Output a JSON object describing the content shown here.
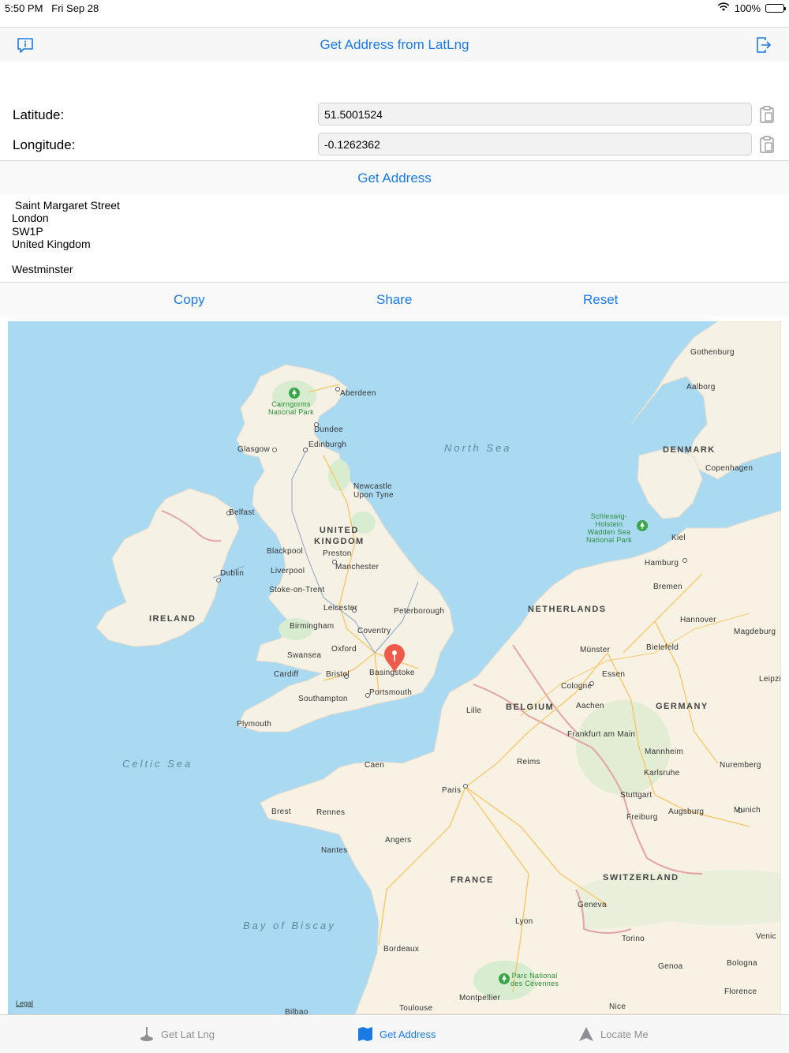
{
  "status": {
    "time": "5:50 PM",
    "date": "Fri Sep 28",
    "battery": "100%",
    "battery_level": 1.0
  },
  "nav": {
    "title": "Get Address from LatLng",
    "left_icon": "info-bubble-icon",
    "right_icon": "logout-icon"
  },
  "form": {
    "latitude_label": "Latitude:",
    "latitude_value": "51.5001524",
    "longitude_label": "Longitude:",
    "longitude_value": "-0.1262362"
  },
  "get_address_button": "Get Address",
  "address": {
    "text": " Saint Margaret Street\nLondon\nSW1P\nUnited Kingdom\n\nWestminster"
  },
  "actions": {
    "copy": "Copy",
    "share": "Share",
    "reset": "Reset"
  },
  "map": {
    "legal": "Legal",
    "labels": {
      "gothenburg": "Gothenburg",
      "aalborg": "Aalborg",
      "aberdeen": "Aberdeen",
      "dundee": "Dundee",
      "glasgow": "Glasgow",
      "edinburgh": "Edinburgh",
      "north_sea": "North Sea",
      "denmark": "DENMARK",
      "copenhagen": "Copenhagen",
      "newcastle": "Newcastle\nUpon Tyne",
      "belfast": "Belfast",
      "united_kingdom": "UNITED\nKINGDOM",
      "blackpool": "Blackpool",
      "preston": "Preston",
      "liverpool": "Liverpool",
      "manchester": "Manchester",
      "dublin": "Dublin",
      "kiel": "Kiel",
      "hamburg": "Hamburg",
      "bremen": "Bremen",
      "stoke": "Stoke-on-Trent",
      "ireland": "IRELAND",
      "leicester": "Leicester",
      "peterborough": "Peterborough",
      "netherlands": "NETHERLANDS",
      "birmingham": "Birmingham",
      "coventry": "Coventry",
      "hannover": "Hannover",
      "magdeburg": "Magdeburg",
      "swansea": "Swansea",
      "oxford": "Oxford",
      "munster": "Münster",
      "bielefeld": "Bielefeld",
      "cardiff": "Cardiff",
      "bristol": "Bristol",
      "basingstoke": "Basingstoke",
      "essen": "Essen",
      "leipzig": "Leipzi",
      "cologne": "Cologne",
      "portsmouth": "Portsmouth",
      "southampton": "Southampton",
      "lille": "Lille",
      "belgium": "BELGIUM",
      "aachen": "Aachen",
      "germany": "GERMANY",
      "plymouth": "Plymouth",
      "frankfurt": "Frankfurt am Main",
      "celtic_sea": "Celtic Sea",
      "caen": "Caen",
      "reims": "Reims",
      "mannheim": "Mannheim",
      "nuremberg": "Nuremberg",
      "paris": "Paris",
      "karlsruhe": "Karlsruhe",
      "brest": "Brest",
      "rennes": "Rennes",
      "stuttgart": "Stuttgart",
      "augsburg": "Augsburg",
      "munich": "Munich",
      "freiburg": "Freiburg",
      "angers": "Angers",
      "nantes": "Nantes",
      "france": "FRANCE",
      "switzerland": "SWITZERLAND",
      "geneva": "Geneva",
      "bay_of_biscay": "Bay of Biscay",
      "lyon": "Lyon",
      "torino": "Torino",
      "venice": "Venic",
      "bordeaux": "Bordeaux",
      "genoa": "Genoa",
      "bologna": "Bologna",
      "florence": "Florence",
      "nice": "Nice",
      "montpellier": "Montpellier",
      "toulouse": "Toulouse",
      "bilbao": "Bilbao",
      "cairngorms": "Cairngorms\nNational Park",
      "wadden": "Schleswig-\nHolstein\nWadden Sea\nNational Park",
      "cevennes": "Parc National\ndes Cévennes"
    }
  },
  "tabs": [
    {
      "label": "Get Lat Lng",
      "icon": "pin-stand-icon",
      "active": false
    },
    {
      "label": "Get Address",
      "icon": "map-icon",
      "active": true
    },
    {
      "label": "Locate Me",
      "icon": "location-arrow-icon",
      "active": false
    }
  ],
  "colors": {
    "accent": "#1a7ae6",
    "water": "#aadaf2",
    "land": "#f7f3e8",
    "pin": "#f05a4a"
  }
}
